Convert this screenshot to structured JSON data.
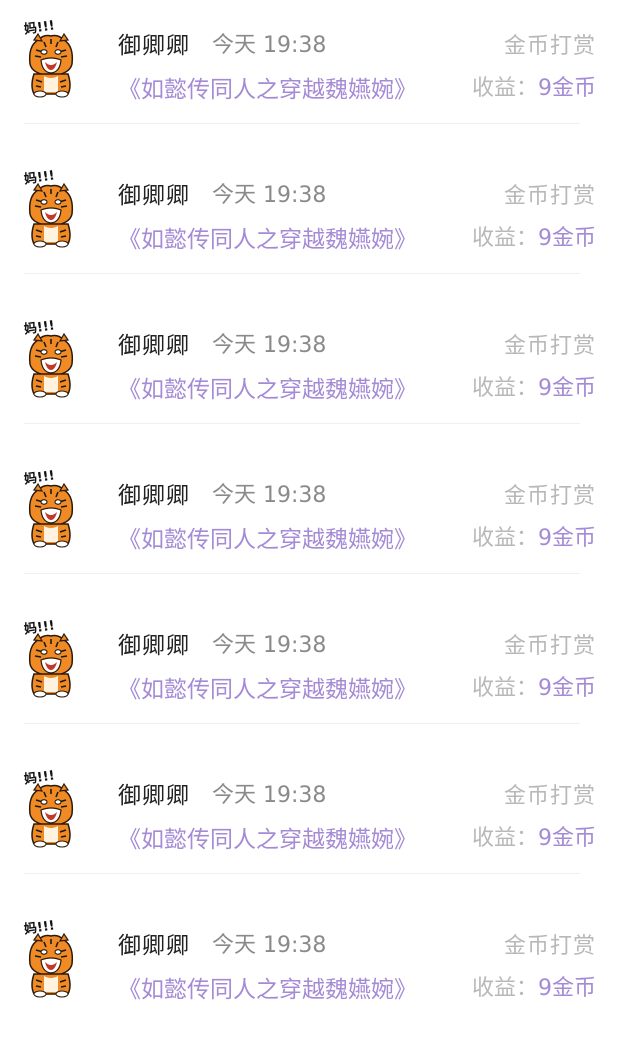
{
  "colors": {
    "book_title": "#a58ad6",
    "muted": "#b8b8b8",
    "time": "#8a8a8a",
    "username": "#222222",
    "divider": "#efefef"
  },
  "rows": [
    {
      "avatar_icon": "tiger-sticker-icon",
      "avatar_text": "妈!!!",
      "username": "御卿卿",
      "time": "今天 19:38",
      "reward_action": "金币打赏",
      "book_title": "《如懿传同人之穿越魏嬿婉》",
      "earnings_label": "收益：",
      "earnings_value": "9金币"
    },
    {
      "avatar_icon": "tiger-sticker-icon",
      "avatar_text": "妈!!!",
      "username": "御卿卿",
      "time": "今天 19:38",
      "reward_action": "金币打赏",
      "book_title": "《如懿传同人之穿越魏嬿婉》",
      "earnings_label": "收益：",
      "earnings_value": "9金币"
    },
    {
      "avatar_icon": "tiger-sticker-icon",
      "avatar_text": "妈!!!",
      "username": "御卿卿",
      "time": "今天 19:38",
      "reward_action": "金币打赏",
      "book_title": "《如懿传同人之穿越魏嬿婉》",
      "earnings_label": "收益：",
      "earnings_value": "9金币"
    },
    {
      "avatar_icon": "tiger-sticker-icon",
      "avatar_text": "妈!!!",
      "username": "御卿卿",
      "time": "今天 19:38",
      "reward_action": "金币打赏",
      "book_title": "《如懿传同人之穿越魏嬿婉》",
      "earnings_label": "收益：",
      "earnings_value": "9金币"
    },
    {
      "avatar_icon": "tiger-sticker-icon",
      "avatar_text": "妈!!!",
      "username": "御卿卿",
      "time": "今天 19:38",
      "reward_action": "金币打赏",
      "book_title": "《如懿传同人之穿越魏嬿婉》",
      "earnings_label": "收益：",
      "earnings_value": "9金币"
    },
    {
      "avatar_icon": "tiger-sticker-icon",
      "avatar_text": "妈!!!",
      "username": "御卿卿",
      "time": "今天 19:38",
      "reward_action": "金币打赏",
      "book_title": "《如懿传同人之穿越魏嬿婉》",
      "earnings_label": "收益：",
      "earnings_value": "9金币"
    },
    {
      "avatar_icon": "tiger-sticker-icon",
      "avatar_text": "妈!!!",
      "username": "御卿卿",
      "time": "今天 19:38",
      "reward_action": "金币打赏",
      "book_title": "《如懿传同人之穿越魏嬿婉》",
      "earnings_label": "收益：",
      "earnings_value": "9金币"
    }
  ]
}
